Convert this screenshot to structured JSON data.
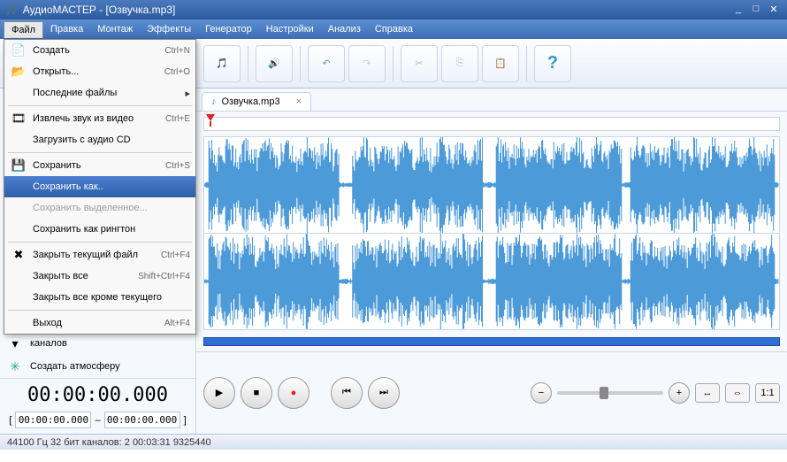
{
  "window": {
    "title": "АудиоМАСТЕР - [Озвучка.mp3]"
  },
  "menubar": [
    "Файл",
    "Правка",
    "Монтаж",
    "Эффекты",
    "Генератор",
    "Настройки",
    "Анализ",
    "Справка"
  ],
  "file_menu": [
    {
      "icon": "📄",
      "label": "Создать",
      "shortcut": "Ctrl+N"
    },
    {
      "icon": "📂",
      "label": "Открыть...",
      "shortcut": "Ctrl+O"
    },
    {
      "icon": "",
      "label": "Последние файлы",
      "shortcut": "",
      "submenu": true
    },
    {
      "sep": true
    },
    {
      "icon": "🎞",
      "label": "Извлечь звук из видео",
      "shortcut": "Ctrl+E"
    },
    {
      "icon": "",
      "label": "Загрузить с аудио CD",
      "shortcut": ""
    },
    {
      "sep": true
    },
    {
      "icon": "💾",
      "label": "Сохранить",
      "shortcut": "Ctrl+S"
    },
    {
      "icon": "",
      "label": "Сохранить как..",
      "shortcut": "",
      "selected": true
    },
    {
      "icon": "",
      "label": "Сохранить выделенное...",
      "shortcut": "",
      "disabled": true
    },
    {
      "icon": "",
      "label": "Сохранить как рингтон",
      "shortcut": ""
    },
    {
      "sep": true
    },
    {
      "icon": "✖",
      "label": "Закрыть текущий файл",
      "shortcut": "Ctrl+F4"
    },
    {
      "icon": "",
      "label": "Закрыть все",
      "shortcut": "Shift+Ctrl+F4"
    },
    {
      "icon": "",
      "label": "Закрыть все кроме текущего",
      "shortcut": ""
    },
    {
      "sep": true
    },
    {
      "icon": "",
      "label": "Выход",
      "shortcut": "Alt+F4"
    }
  ],
  "sidebar": {
    "channels": "каналов",
    "atmosphere": "Создать атмосферу"
  },
  "tab": {
    "name": "Озвучка.mp3"
  },
  "time": {
    "current": "00:00:00.000",
    "start": "00:00:00.000",
    "end": "00:00:00.000",
    "sep": "–"
  },
  "zoom": {
    "ratio": "1:1"
  },
  "status": "44100 Гц  32 бит  каналов: 2    00:03:31 9325440",
  "colors": {
    "wave": "#4d9ad9",
    "accent": "#2e6fd1"
  }
}
